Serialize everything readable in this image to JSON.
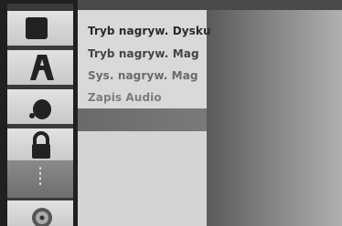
{
  "menu": {
    "items": [
      {
        "label": "Tryb nagryw. Dysku",
        "state": "selected"
      },
      {
        "label": "Tryb nagryw. Mag",
        "state": "normal"
      },
      {
        "label": "Sys. nagryw. Mag",
        "state": "dimmed"
      },
      {
        "label": "Zapis Audio",
        "state": "dimmed"
      }
    ]
  },
  "sidebar": {
    "icons": [
      {
        "name": "disc-icon"
      },
      {
        "name": "language-icon"
      },
      {
        "name": "audio-icon"
      },
      {
        "name": "lock-icon"
      },
      {
        "name": "recording-icon",
        "active": true
      },
      {
        "name": "others-icon"
      }
    ]
  },
  "colors": {
    "panel": "#d9d9d9",
    "sidebar_tile": "#d6d6d6",
    "active_tile": "#7c7c7c",
    "text_primary": "#2a2a2a",
    "text_dim": "#7c7c7c"
  }
}
